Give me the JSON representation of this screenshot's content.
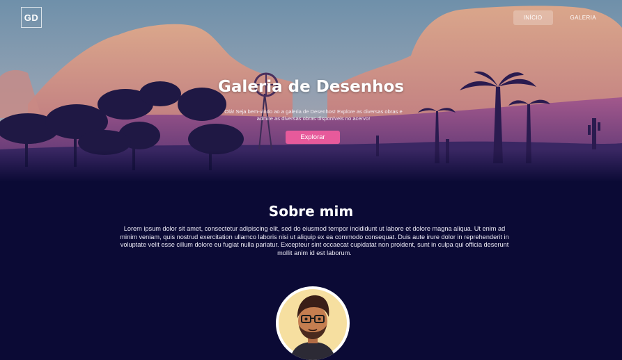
{
  "header": {
    "logo_text": "GD",
    "nav": [
      {
        "label": "INÍCIO",
        "active": true
      },
      {
        "label": "GALERIA",
        "active": false
      }
    ]
  },
  "hero": {
    "title": "Galeria de Desenhos",
    "text": "Olá! Seja bem-vindo ao a galeria de Desenhos! Explore  as diversas obras e admire as diversas obras disponíveis no acervo!",
    "button_label": "Explorar"
  },
  "about": {
    "title": "Sobre mim",
    "text": "Lorem ipsum dolor sit amet, consectetur adipiscing elit, sed do eiusmod tempor incididunt ut labore et dolore magna aliqua. Ut enim ad minim veniam, quis nostrud exercitation ullamco laboris nisi ut aliquip ex ea commodo consequat. Duis aute irure dolor in reprehenderit in voluptate velit esse cillum dolore eu fugiat nulla pariatur. Excepteur sint occaecat cupidatat non proident, sunt in culpa qui officia deserunt mollit anim id est laborum."
  },
  "colors": {
    "background": "#0b0a35",
    "accent": "#e75a9b"
  }
}
